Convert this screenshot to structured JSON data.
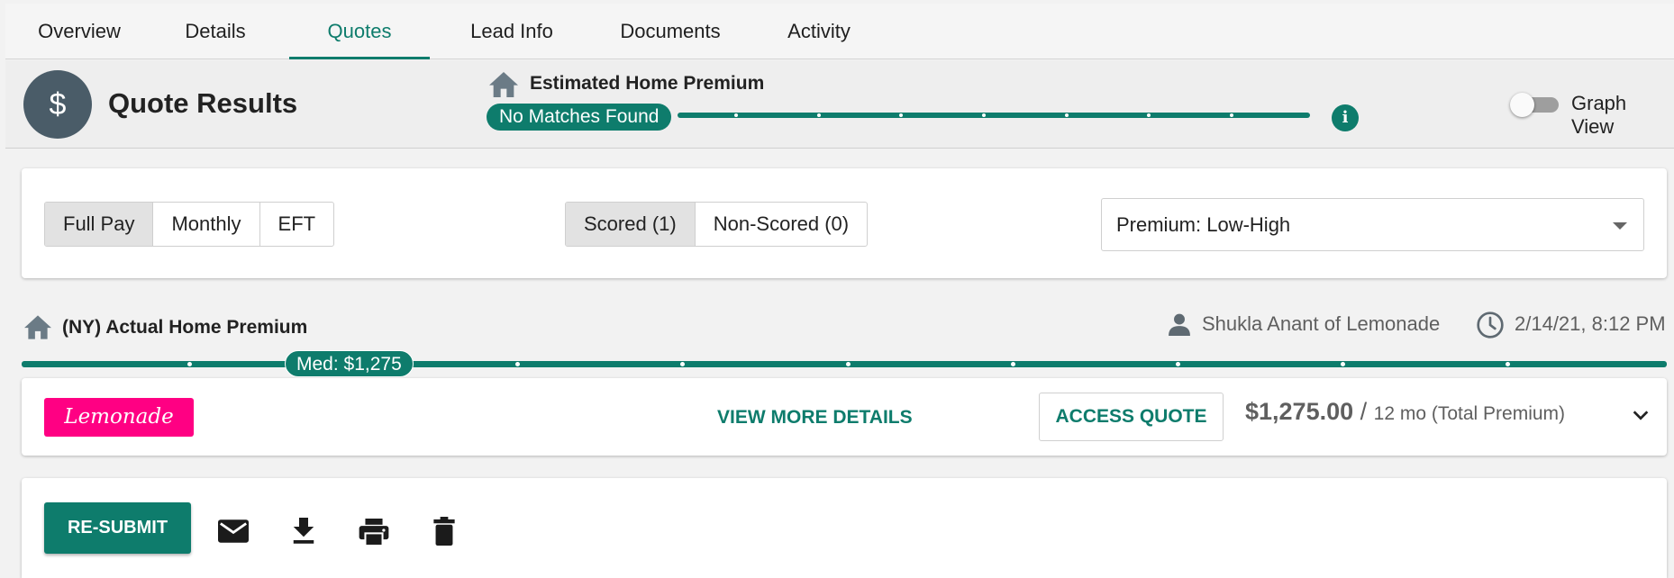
{
  "tabs": [
    {
      "label": "Overview"
    },
    {
      "label": "Details"
    },
    {
      "label": "Quotes",
      "active": true
    },
    {
      "label": "Lead Info"
    },
    {
      "label": "Documents"
    },
    {
      "label": "Activity"
    }
  ],
  "header": {
    "badge_symbol": "$",
    "title": "Quote Results",
    "estimate_title": "Estimated Home Premium",
    "no_match_label": "No Matches Found",
    "info_symbol": "i",
    "graph_view_label": "Graph View",
    "graph_view_on": false
  },
  "filters": {
    "payment_options": [
      "Full Pay",
      "Monthly",
      "EFT"
    ],
    "payment_selected": "Full Pay",
    "score_options": [
      "Scored (1)",
      "Non-Scored (0)"
    ],
    "score_selected": "Scored (1)",
    "sort_value": "Premium: Low-High"
  },
  "actual": {
    "title": "(NY) Actual Home Premium",
    "agent": "Shukla Anant of Lemonade",
    "datetime": "2/14/21, 8:12 PM",
    "median_label": "Med:  $1,275"
  },
  "quote": {
    "carrier_logo_text": "Lemonade",
    "view_details_label": "VIEW MORE DETAILS",
    "access_label": "ACCESS QUOTE",
    "price": "$1,275.00",
    "slash": " / ",
    "term": "12 mo (Total Premium)"
  },
  "actions": {
    "resubmit_label": "RE-SUBMIT",
    "icons": [
      "email-icon",
      "download-icon",
      "print-icon",
      "delete-icon"
    ]
  },
  "colors": {
    "accent": "#0e7c6c",
    "badge": "#4a5c68",
    "lemonade_brand": "#ff0083"
  }
}
